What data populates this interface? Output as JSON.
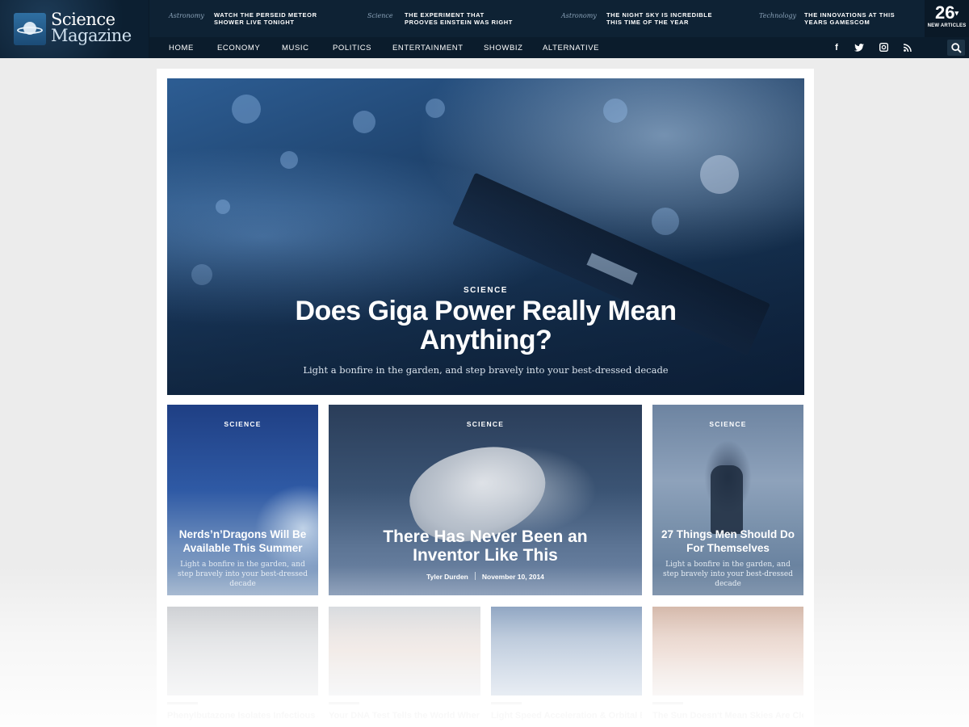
{
  "site": {
    "logo_line1": "Science",
    "logo_line2": "Magazine"
  },
  "ticker": [
    {
      "category": "Astronomy",
      "headline": "WATCH THE PERSEID METEOR SHOWER LIVE TONIGHT"
    },
    {
      "category": "Science",
      "headline": "THE EXPERIMENT THAT PROOVES EINSTEIN WAS RIGHT"
    },
    {
      "category": "Astronomy",
      "headline": "THE NIGHT SKY IS INCREDIBLE THIS TIME OF THE YEAR"
    },
    {
      "category": "Technology",
      "headline": "THE INNOVATIONS AT THIS YEARS GAMESCOM"
    }
  ],
  "new_articles": {
    "count": "26",
    "label": "NEW ARTICLES"
  },
  "nav": [
    "HOME",
    "ECONOMY",
    "MUSIC",
    "POLITICS",
    "ENTERTAINMENT",
    "SHOWBIZ",
    "ALTERNATIVE"
  ],
  "social_icons": [
    "facebook-icon",
    "twitter-icon",
    "instagram-icon",
    "rss-icon",
    "search-icon"
  ],
  "hero": {
    "category": "SCIENCE",
    "title": "Does Giga Power Really Mean Anything?",
    "subtitle": "Light a bonfire in the garden, and step bravely into your best-dressed decade"
  },
  "cards": [
    {
      "category": "SCIENCE",
      "title": "Nerds’n’Dragons Will Be Available This Summer",
      "desc": "Light a bonfire in the garden, and step bravely into your best-dressed decade"
    },
    {
      "category": "SCIENCE",
      "title": "There Has Never Been an Inventor Like This",
      "author": "Tyler Durden",
      "date": "November 10, 2014"
    },
    {
      "category": "SCIENCE",
      "title": "27 Things Men Should Do For Themselves",
      "desc": "Light a bonfire in the garden, and step bravely into your best-dressed decade"
    }
  ],
  "thumbs": [
    {
      "title": "Phenylbutazone Isolates Infectious Sclerosis"
    },
    {
      "title": "Your DNA Test Tells the World Where You Come From"
    },
    {
      "title": "Light Speed Acceleration & Orbital Expansion"
    },
    {
      "title": "The Sun Doesn't Mean Skies Are Clear"
    }
  ],
  "colors": {
    "header_bg": "#0e2234",
    "nav_bg": "#0b1c2c",
    "page_bg": "#ececec"
  }
}
